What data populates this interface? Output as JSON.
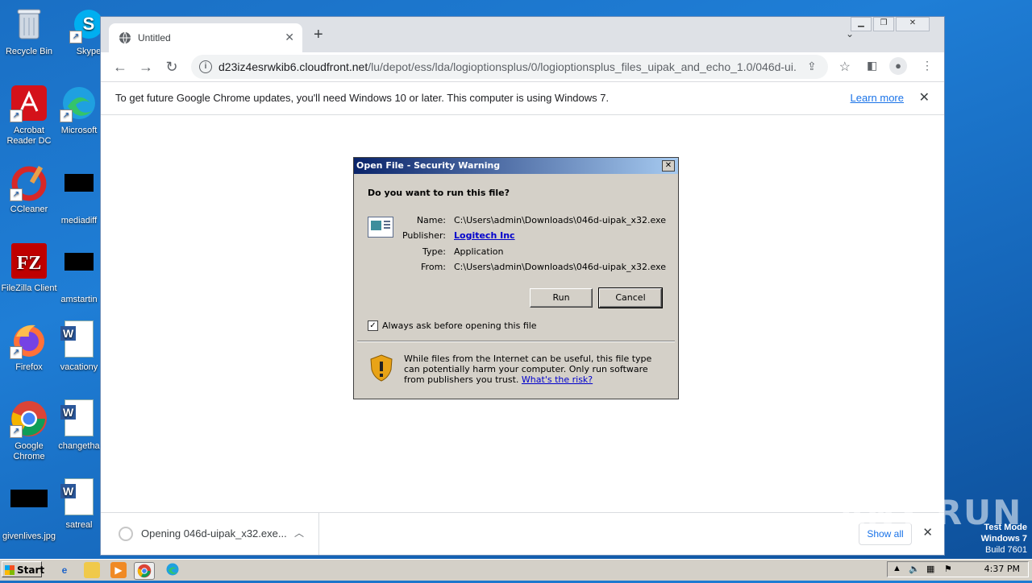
{
  "desktop": {
    "icons": [
      {
        "label": "Recycle Bin"
      },
      {
        "label": "Skype"
      },
      {
        "label": "Acrobat Reader DC"
      },
      {
        "label": "Microsoft"
      },
      {
        "label": "CCleaner"
      },
      {
        "label": "mediadiff"
      },
      {
        "label": "FileZilla Client"
      },
      {
        "label": "amstartin"
      },
      {
        "label": "Firefox"
      },
      {
        "label": "vacationy"
      },
      {
        "label": "Google Chrome"
      },
      {
        "label": "changetha"
      },
      {
        "label": "givenlives.jpg"
      },
      {
        "label": "satreal"
      }
    ]
  },
  "browser": {
    "tab_title": "Untitled",
    "url_domain": "d23iz4esrwkib6.cloudfront.net",
    "url_path": "/lu/depot/ess/lda/logioptionsplus/0/logioptionsplus_files_uipak_and_echo_1.0/046d-ui...",
    "infobar": {
      "message": "To get future Google Chrome updates, you'll need Windows 10 or later. This computer is using Windows 7.",
      "link": "Learn more"
    },
    "download": {
      "item": "Opening 046d-uipak_x32.exe...",
      "show_all": "Show all"
    }
  },
  "dialog": {
    "title": "Open File - Security Warning",
    "question": "Do you want to run this file?",
    "fields": {
      "name_label": "Name:",
      "name_value": "C:\\Users\\admin\\Downloads\\046d-uipak_x32.exe",
      "publisher_label": "Publisher:",
      "publisher_value": "Logitech Inc",
      "type_label": "Type:",
      "type_value": "Application",
      "from_label": "From:",
      "from_value": "C:\\Users\\admin\\Downloads\\046d-uipak_x32.exe"
    },
    "run_label": "Run",
    "cancel_label": "Cancel",
    "checkbox_label": "Always ask before opening this file",
    "checkbox_checked": true,
    "warning_text": "While files from the Internet can be useful, this file type can potentially harm your computer. Only run software from publishers you trust.",
    "warning_link": "What's the risk?"
  },
  "taskbar": {
    "start_label": "Start",
    "clock": "4:37 PM"
  },
  "overlay": {
    "watermark": "ANY RUN",
    "test_mode": "Test Mode",
    "os": "Windows 7",
    "build": "Build 7601"
  }
}
